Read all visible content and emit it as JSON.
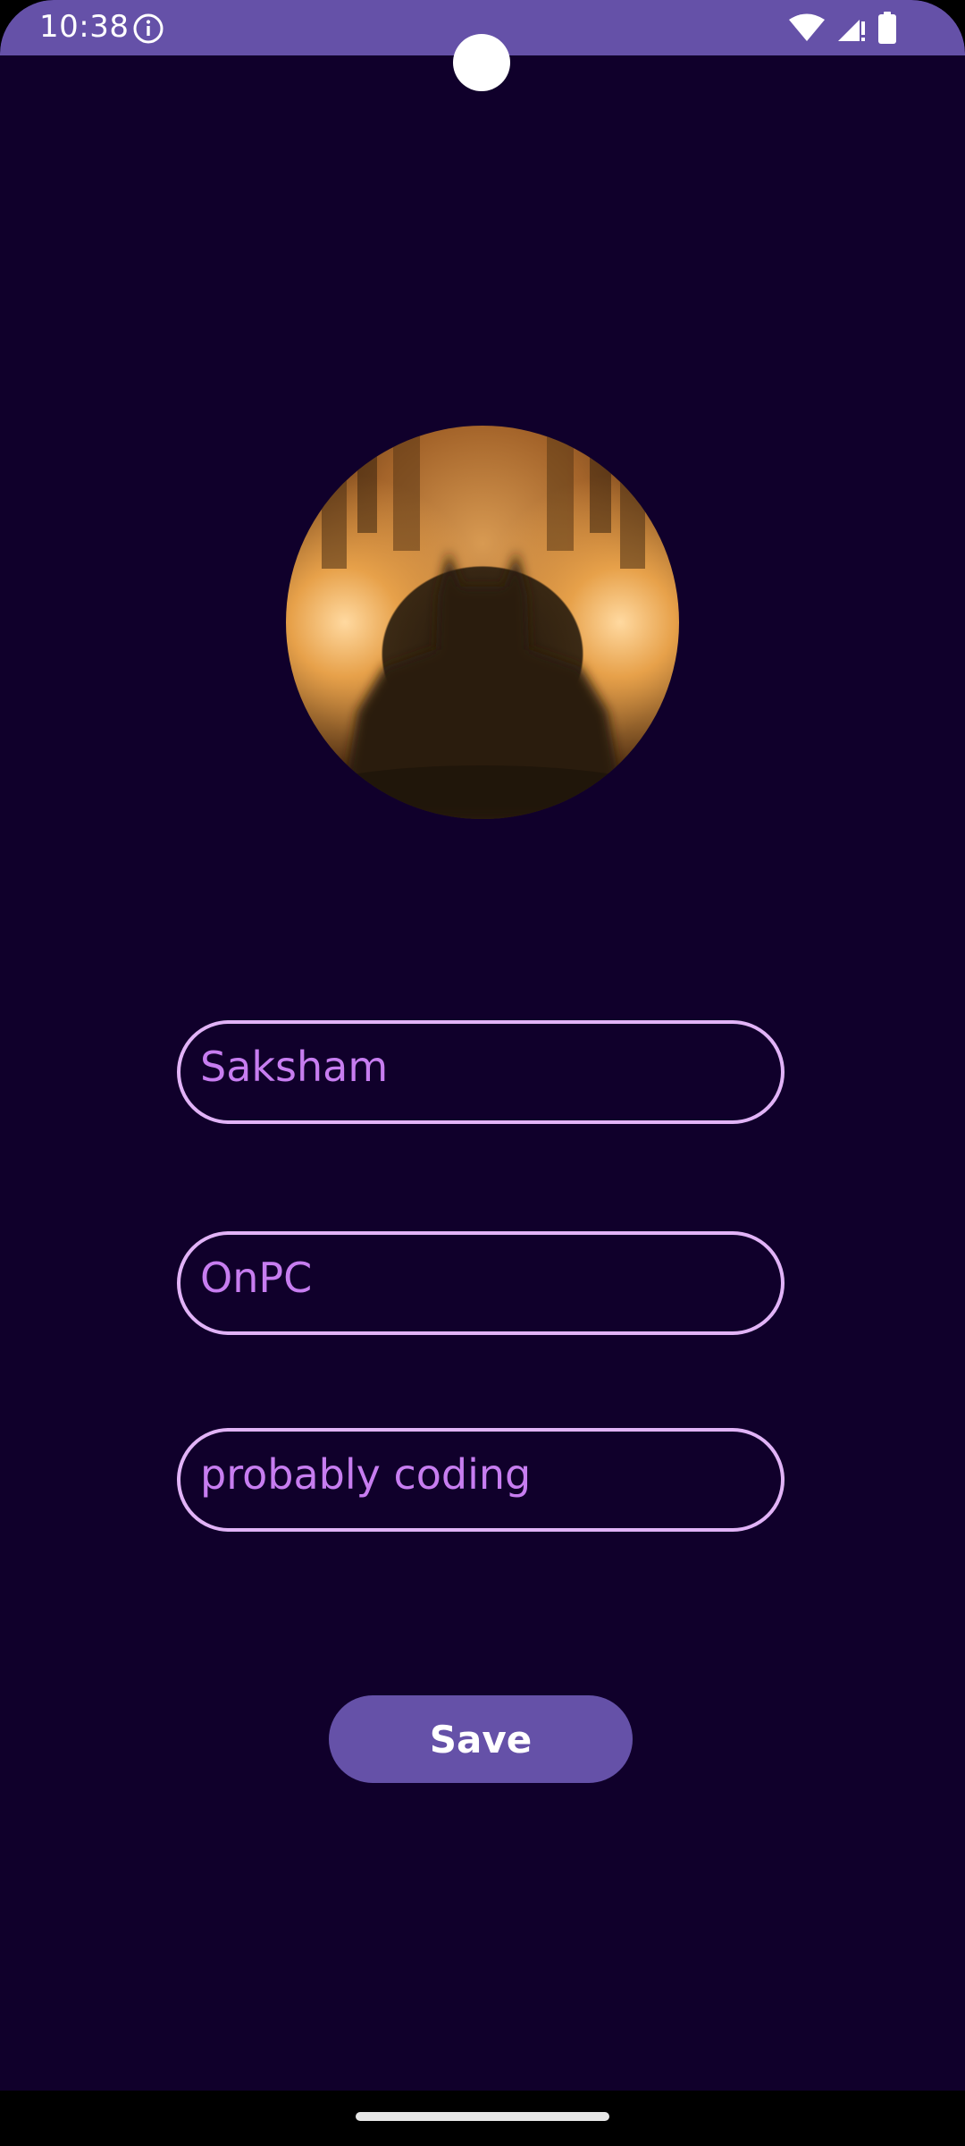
{
  "status_bar": {
    "time": "10:38",
    "icons": [
      "info-icon",
      "wifi-icon",
      "cellular-signal-icon",
      "battery-icon"
    ]
  },
  "profile": {
    "avatar_description": "batman-silhouette-avatar"
  },
  "form": {
    "name_value": "Saksham",
    "status_value": "OnPC",
    "activity_value": "probably coding",
    "save_label": "Save"
  },
  "colors": {
    "background": "#10002B",
    "accent": "#6551A8",
    "field_border": "#E1B3F7",
    "field_text": "#C77DF0"
  }
}
